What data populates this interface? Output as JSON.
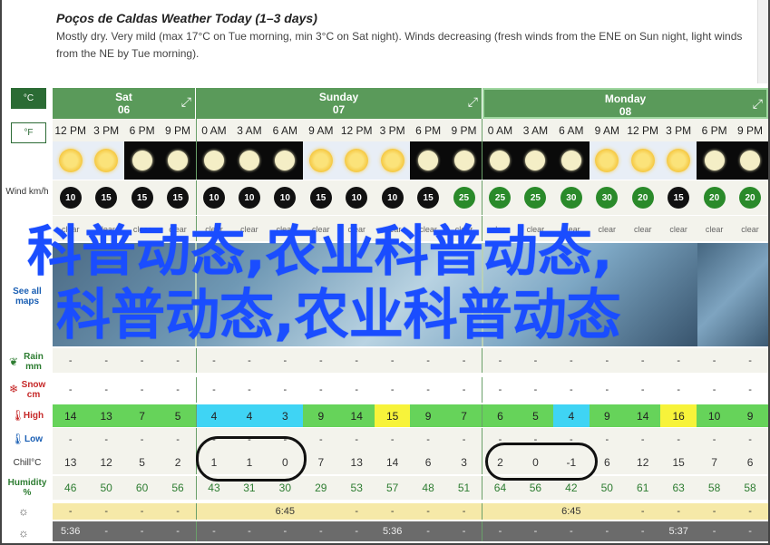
{
  "forecast": {
    "title": "Poços de Caldas Weather Today (1–3 days)",
    "summary": "Mostly dry. Very mild (max 17°C on Tue morning, min 3°C on Sat night). Winds decreasing (fresh winds from the ENE on Sun night, light winds from the NE by Tue morning)."
  },
  "units": {
    "celsius": "°C",
    "fahrenheit": "°F"
  },
  "row_labels": {
    "wind": "Wind km/h",
    "maps": "See all maps",
    "rain": "Rain mm",
    "snow": "Snow cm",
    "high": "High",
    "low": "Low",
    "chill": "Chill°C",
    "humidity": "Humidity %"
  },
  "days": [
    {
      "name": "Sat",
      "date": "06"
    },
    {
      "name": "Sunday",
      "date": "07"
    },
    {
      "name": "Monday",
      "date": "08"
    }
  ],
  "times": [
    "12 PM",
    "3 PM",
    "6 PM",
    "9 PM",
    "0 AM",
    "3 AM",
    "6 AM",
    "9 AM",
    "12 PM",
    "3 PM",
    "6 PM",
    "9 PM",
    "0 AM",
    "3 AM",
    "6 AM",
    "9 AM",
    "12 PM",
    "3 PM",
    "6 PM",
    "9 PM"
  ],
  "sky": [
    "sun",
    "sun",
    "moon",
    "moon",
    "moon",
    "moon",
    "moon",
    "sun",
    "sun",
    "sun",
    "moon",
    "moon",
    "moon",
    "moon",
    "moon",
    "sun",
    "sun",
    "sun",
    "moon",
    "moon"
  ],
  "wind": [
    "10",
    "15",
    "15",
    "15",
    "10",
    "10",
    "10",
    "15",
    "10",
    "10",
    "15",
    "25",
    "25",
    "25",
    "30",
    "30",
    "20",
    "15",
    "20",
    "20"
  ],
  "wind_colors": {
    "default": "#111111",
    "strong": "#2a8a2a"
  },
  "summary_text": [
    "clear",
    "clear",
    "clear",
    "clear",
    "clear",
    "clear",
    "clear",
    "clear",
    "clear",
    "clear",
    "clear",
    "clear",
    "clear",
    "clear",
    "clear",
    "clear",
    "clear",
    "clear",
    "clear",
    "clear"
  ],
  "rain": [
    "-",
    "-",
    "-",
    "-",
    "-",
    "-",
    "-",
    "-",
    "-",
    "-",
    "-",
    "-",
    "-",
    "-",
    "-",
    "-",
    "-",
    "-",
    "-",
    "-"
  ],
  "snow": [
    "-",
    "-",
    "-",
    "-",
    "-",
    "-",
    "-",
    "-",
    "-",
    "-",
    "-",
    "-",
    "-",
    "-",
    "-",
    "-",
    "-",
    "-",
    "-",
    "-"
  ],
  "high": [
    "14",
    "13",
    "7",
    "5",
    "4",
    "4",
    "3",
    "9",
    "14",
    "15",
    "9",
    "7",
    "6",
    "5",
    "4",
    "9",
    "14",
    "16",
    "10",
    "9"
  ],
  "high_colors": [
    "#66d35a",
    "#66d35a",
    "#66d35a",
    "#66d35a",
    "#3fd4f4",
    "#3fd4f4",
    "#3fd4f4",
    "#66d35a",
    "#66d35a",
    "#f7f33a",
    "#66d35a",
    "#66d35a",
    "#66d35a",
    "#66d35a",
    "#3fd4f4",
    "#66d35a",
    "#66d35a",
    "#f7f33a",
    "#66d35a",
    "#66d35a"
  ],
  "low": [
    "-",
    "-",
    "-",
    "-",
    "-",
    "-",
    "-",
    "-",
    "-",
    "-",
    "-",
    "-",
    "-",
    "-",
    "-",
    "-",
    "-",
    "-",
    "-",
    "-"
  ],
  "chill": [
    "13",
    "12",
    "5",
    "2",
    "1",
    "1",
    "0",
    "7",
    "13",
    "14",
    "6",
    "3",
    "2",
    "0",
    "-1",
    "6",
    "12",
    "15",
    "7",
    "6"
  ],
  "humidity": [
    "46",
    "50",
    "60",
    "56",
    "43",
    "31",
    "30",
    "29",
    "53",
    "57",
    "48",
    "51",
    "64",
    "56",
    "42",
    "50",
    "61",
    "63",
    "58",
    "58"
  ],
  "sunrise": [
    "-",
    "-",
    "-",
    "-",
    "",
    "",
    "6:45",
    "",
    "-",
    "-",
    "-",
    "-",
    "",
    "",
    "6:45",
    "",
    "-",
    "-",
    "-",
    "-"
  ],
  "sunset": [
    "5:36",
    "-",
    "-",
    "-",
    "-",
    "-",
    "-",
    "-",
    "-",
    "5:36",
    "-",
    "-",
    "-",
    "-",
    "-",
    "-",
    "-",
    "5:37",
    "-",
    "-"
  ],
  "overlay": {
    "line1": "科普动态,农业科普动态,",
    "line2": "科普动态,农业科普动态"
  }
}
